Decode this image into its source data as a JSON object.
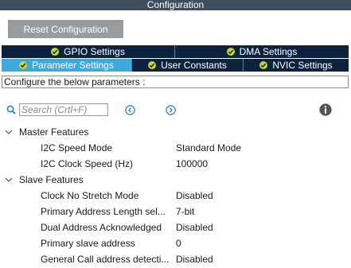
{
  "window": {
    "title": "Configuration"
  },
  "toolbar": {
    "reset_label": "Reset Configuration"
  },
  "tabs_row1": [
    {
      "label": "GPIO Settings",
      "active": false
    },
    {
      "label": "DMA Settings",
      "active": false
    }
  ],
  "tabs_row2": [
    {
      "label": "Parameter Settings",
      "active": true
    },
    {
      "label": "User Constants",
      "active": false
    },
    {
      "label": "NVIC Settings",
      "active": false
    }
  ],
  "description": "Configure the below parameters :",
  "search": {
    "placeholder": "Search (Crtl+F)",
    "value": ""
  },
  "colors": {
    "title_bar": "#3f4e5e",
    "tab_bg": "#0c2340",
    "tab_active": "#3fa9dc",
    "check_badge": "#c8d82a"
  },
  "icons": {
    "search": "search-icon",
    "prev": "chevron-left-circle-icon",
    "next": "chevron-right-circle-icon",
    "info": "info-icon",
    "check": "check-badge-icon",
    "expand": "chevron-down-icon"
  },
  "groups": [
    {
      "title": "Master Features",
      "expanded": true,
      "params": [
        {
          "name": "I2C Speed Mode",
          "value": "Standard Mode"
        },
        {
          "name": "I2C Clock Speed (Hz)",
          "value": "100000"
        }
      ]
    },
    {
      "title": "Slave Features",
      "expanded": true,
      "params": [
        {
          "name": "Clock No Stretch Mode",
          "value": "Disabled"
        },
        {
          "name": "Primary Address Length sel...",
          "value": "7-bit"
        },
        {
          "name": "Dual Address Acknowledged",
          "value": "Disabled"
        },
        {
          "name": "Primary slave address",
          "value": "0"
        },
        {
          "name": "General Call address detecti...",
          "value": "Disabled"
        }
      ]
    }
  ]
}
